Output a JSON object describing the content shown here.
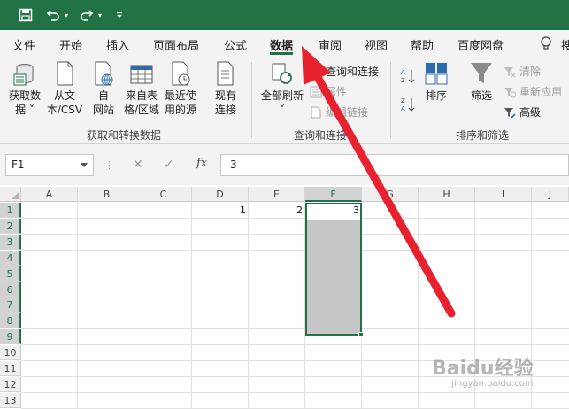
{
  "qat": {
    "save_icon": "save-icon",
    "undo_icon": "undo-icon",
    "redo_icon": "redo-icon",
    "customize_icon": "customize-icon",
    "accent_color": "#217346"
  },
  "tabs": [
    {
      "label": "文件"
    },
    {
      "label": "开始"
    },
    {
      "label": "插入"
    },
    {
      "label": "页面布局"
    },
    {
      "label": "公式"
    },
    {
      "label": "数据",
      "active": true
    },
    {
      "label": "审阅"
    },
    {
      "label": "视图"
    },
    {
      "label": "帮助"
    },
    {
      "label": "百度网盘"
    },
    {
      "label": "搜"
    }
  ],
  "ribbon": {
    "get_transform": {
      "get_data": {
        "line1": "获取数",
        "line2": "据 ˅"
      },
      "from_csv": {
        "line1": "从文",
        "line2": "本/CSV"
      },
      "from_web": {
        "line1": "自",
        "line2": "网站"
      },
      "from_table": {
        "line1": "来自表",
        "line2": "格/区域"
      },
      "recent_sources": {
        "line1": "最近使",
        "line2": "用的源"
      },
      "existing": {
        "line1": "现有",
        "line2": "连接"
      },
      "group_label": "获取和转换数据"
    },
    "queries": {
      "refresh_all": {
        "line1": "全部刷新",
        "line2": "˅"
      },
      "queries_connections": "查询和连接",
      "properties": "属性",
      "edit_links": "编辑链接",
      "group_label": "查询和连接"
    },
    "sort_filter": {
      "sort": "排序",
      "filter": "筛选",
      "clear": "清除",
      "reapply": "重新应用",
      "advanced": "高级",
      "group_label": "排序和筛选"
    }
  },
  "formula_bar": {
    "name_box": "F1",
    "fx_label": "fx",
    "value": "3"
  },
  "sheet": {
    "columns": [
      "A",
      "B",
      "C",
      "D",
      "E",
      "F",
      "G",
      "H",
      "I",
      "J"
    ],
    "rows": [
      "1",
      "2",
      "3",
      "4",
      "5",
      "6",
      "7",
      "8",
      "9",
      "10",
      "11",
      "12",
      "13"
    ],
    "selected_column": "F",
    "active_cell": "F1",
    "selection_range": "F1:F9",
    "cells": [
      {
        "ref": "D1",
        "value": "1"
      },
      {
        "ref": "E1",
        "value": "2"
      },
      {
        "ref": "F1",
        "value": "3"
      }
    ]
  },
  "annotation": {
    "type": "red-arrow",
    "target": "tab-data",
    "color": "#e8212e"
  },
  "watermark": {
    "main": "Baidu经验",
    "sub": "jingyan.baidu.com"
  }
}
